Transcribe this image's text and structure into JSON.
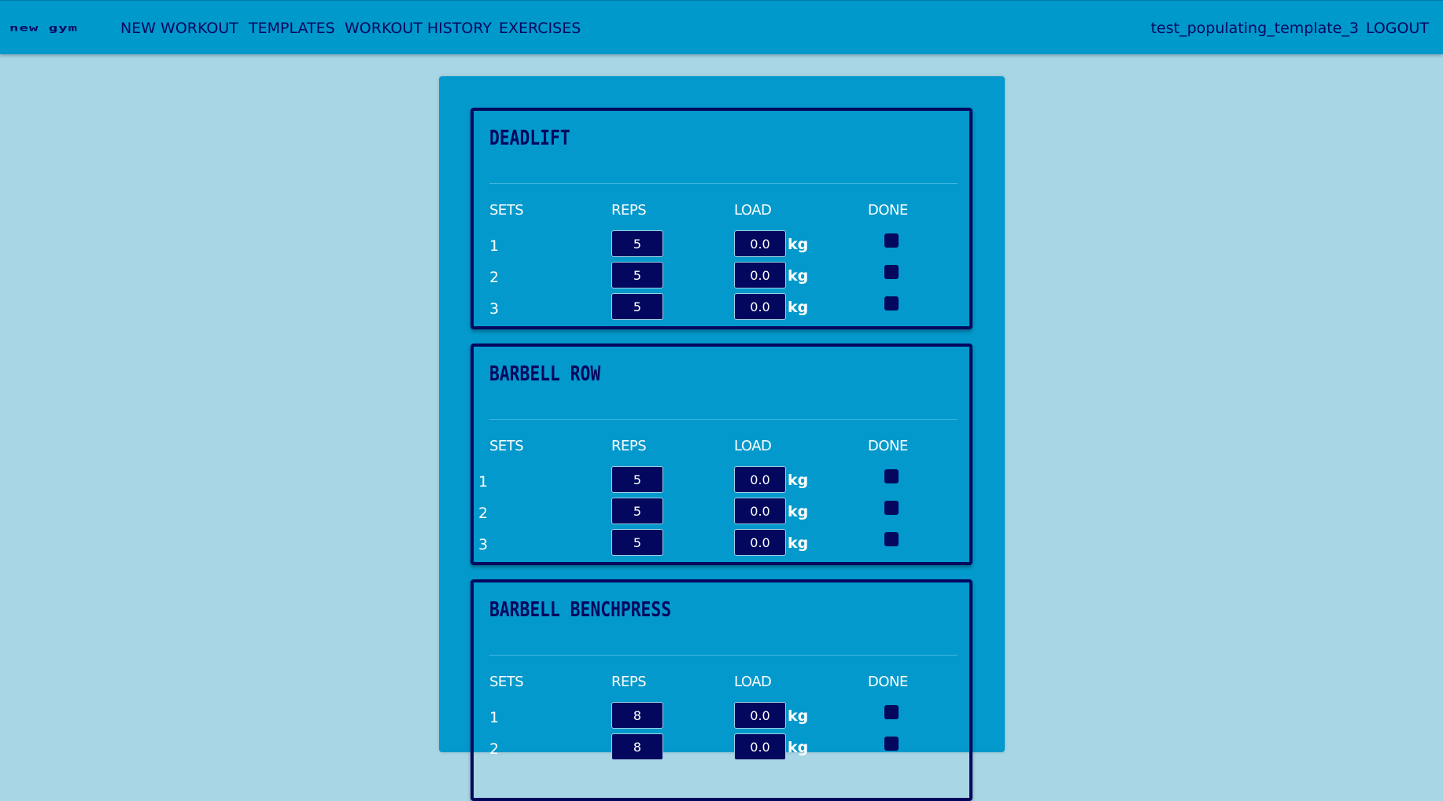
{
  "nav": {
    "brand": "new gym",
    "links": [
      "NEW WORKOUT",
      "TEMPLATES",
      "WORKOUT HISTORY",
      "EXERCISES"
    ],
    "username": "test_populating_template_3",
    "logout": "LOGOUT"
  },
  "columns": {
    "sets": "SETS",
    "reps": "REPS",
    "load": "LOAD",
    "done": "DONE"
  },
  "unit": "kg",
  "exercises": [
    {
      "name": "DEADLIFT",
      "sets": [
        {
          "set": "1",
          "reps": "5",
          "load": "0.0",
          "done": false
        },
        {
          "set": "2",
          "reps": "5",
          "load": "0.0",
          "done": false
        },
        {
          "set": "3",
          "reps": "5",
          "load": "0.0",
          "done": false
        }
      ]
    },
    {
      "name": "BARBELL ROW",
      "sets": [
        {
          "set": "1",
          "reps": "5",
          "load": "0.0",
          "done": false
        },
        {
          "set": "2",
          "reps": "5",
          "load": "0.0",
          "done": false
        },
        {
          "set": "3",
          "reps": "5",
          "load": "0.0",
          "done": false
        }
      ]
    },
    {
      "name": "BARBELL BENCHPRESS",
      "sets": [
        {
          "set": "1",
          "reps": "8",
          "load": "0.0",
          "done": false
        },
        {
          "set": "2",
          "reps": "8",
          "load": "0.0",
          "done": false
        }
      ]
    }
  ],
  "colors": {
    "page_bg": "#a8d6e5",
    "navbar": "#0099cc",
    "card": "#0399cc",
    "navy": "#03085e",
    "text_light": "#ffffff"
  }
}
